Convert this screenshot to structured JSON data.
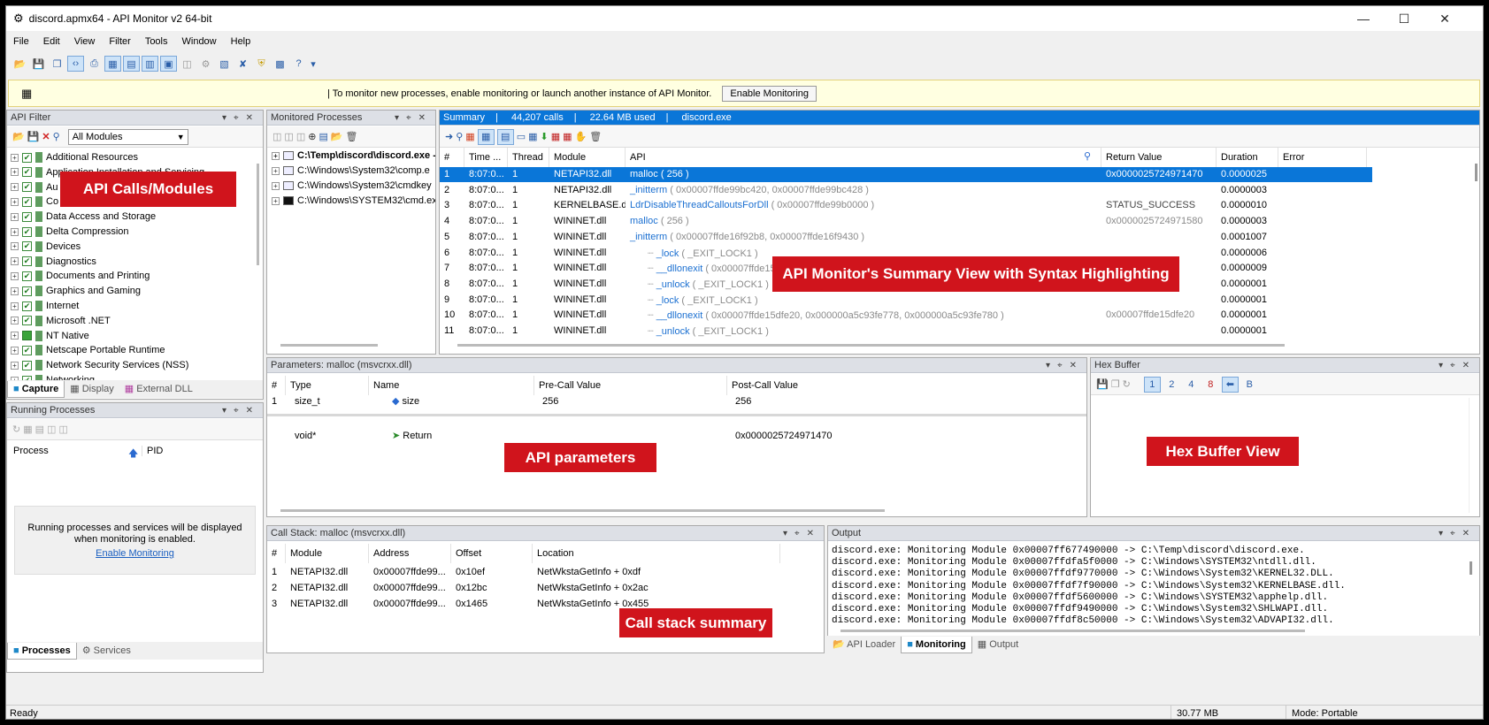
{
  "window": {
    "title": "discord.apmx64 - API Monitor v2 64-bit"
  },
  "menu": [
    "File",
    "Edit",
    "View",
    "Filter",
    "Tools",
    "Window",
    "Help"
  ],
  "infobar": {
    "message": "|  To monitor new processes, enable monitoring or launch another instance of API Monitor.",
    "button": "Enable Monitoring"
  },
  "api_filter": {
    "title": "API Filter",
    "module_select": "All Modules",
    "items": [
      "Additional Resources",
      "Application Installation and Servicing",
      "Au",
      "Co",
      "Data Access and Storage",
      "Delta Compression",
      "Devices",
      "Diagnostics",
      "Documents and Printing",
      "Graphics and Gaming",
      "Internet",
      "Microsoft .NET",
      "NT Native",
      "Netscape Portable Runtime",
      "Network Security Services (NSS)",
      "Networking"
    ],
    "tabs": [
      "Capture",
      "Display",
      "External DLL"
    ]
  },
  "monitored": {
    "title": "Monitored Processes",
    "items": [
      "C:\\Temp\\discord\\discord.exe -",
      "C:\\Windows\\System32\\comp.e",
      "C:\\Windows\\System32\\cmdkey",
      "C:\\Windows\\SYSTEM32\\cmd.ex"
    ]
  },
  "summary": {
    "header": {
      "label": "Summary",
      "calls": "44,207 calls",
      "mem": "22.64 MB used",
      "proc": "discord.exe"
    },
    "columns": [
      "#",
      "Time ...",
      "Thread",
      "Module",
      "API",
      "Return Value",
      "Duration",
      "Error"
    ],
    "rows": [
      {
        "n": "1",
        "time": "8:07:0...",
        "thread": "1",
        "module": "NETAPI32.dll",
        "fn": "malloc",
        "args": " ( 256 )",
        "ret": "0x0000025724971470",
        "dur": "0.0000025"
      },
      {
        "n": "2",
        "time": "8:07:0...",
        "thread": "1",
        "module": "NETAPI32.dll",
        "fn": "_initterm",
        "args": " ( 0x00007ffde99bc420, 0x00007ffde99bc428 )",
        "ret": "",
        "dur": "0.0000003"
      },
      {
        "n": "3",
        "time": "8:07:0...",
        "thread": "1",
        "module": "KERNELBASE.dll",
        "fn": "LdrDisableThreadCalloutsForDll",
        "args": " ( 0x00007ffde99b0000 )",
        "ret": "STATUS_SUCCESS",
        "dur": "0.0000010"
      },
      {
        "n": "4",
        "time": "8:07:0...",
        "thread": "1",
        "module": "WININET.dll",
        "fn": "malloc",
        "args": " ( 256 )",
        "ret": "0x0000025724971580",
        "dur": "0.0000003"
      },
      {
        "n": "5",
        "time": "8:07:0...",
        "thread": "1",
        "module": "WININET.dll",
        "fn": "_initterm",
        "args": " ( 0x00007ffde16f92b8, 0x00007ffde16f9430 )",
        "ret": "",
        "dur": "0.0001007"
      },
      {
        "n": "6",
        "time": "8:07:0...",
        "thread": "1",
        "module": "WININET.dll",
        "fn": "_lock",
        "args": " ( _EXIT_LOCK1 )",
        "ret": "",
        "dur": "0.0000006"
      },
      {
        "n": "7",
        "time": "8:07:0...",
        "thread": "1",
        "module": "WININET.dll",
        "fn": "__dllonexit",
        "args": " ( 0x00007ffde15dfd",
        "ret": "a0",
        "dur": "0.0000009"
      },
      {
        "n": "8",
        "time": "8:07:0...",
        "thread": "1",
        "module": "WININET.dll",
        "fn": "_unlock",
        "args": " ( _EXIT_LOCK1 )",
        "ret": "",
        "dur": "0.0000001"
      },
      {
        "n": "9",
        "time": "8:07:0...",
        "thread": "1",
        "module": "WININET.dll",
        "fn": "_lock",
        "args": " ( _EXIT_LOCK1 )",
        "ret": "",
        "dur": "0.0000001"
      },
      {
        "n": "10",
        "time": "8:07:0...",
        "thread": "1",
        "module": "WININET.dll",
        "fn": "__dllonexit",
        "args": " ( 0x00007ffde15dfe20, 0x000000a5c93fe778, 0x000000a5c93fe780 )",
        "ret": "0x00007ffde15dfe20",
        "dur": "0.0000001"
      },
      {
        "n": "11",
        "time": "8:07:0...",
        "thread": "1",
        "module": "WININET.dll",
        "fn": "_unlock",
        "args": " ( _EXIT_LOCK1 )",
        "ret": "",
        "dur": "0.0000001"
      }
    ]
  },
  "params": {
    "title": "Parameters: malloc (msvcrxx.dll)",
    "columns": [
      "#",
      "Type",
      "Name",
      "Pre-Call Value",
      "Post-Call Value"
    ],
    "row1": {
      "n": "1",
      "type": "size_t",
      "name": "size",
      "pre": "256",
      "post": "256"
    },
    "ret": {
      "type": "void*",
      "name": "Return",
      "post": "0x0000025724971470"
    }
  },
  "hex": {
    "title": "Hex Buffer",
    "buttons": [
      "1",
      "2",
      "4",
      "8",
      "B"
    ]
  },
  "running": {
    "title": "Running Processes",
    "cols": [
      "Process",
      "PID"
    ],
    "msg1": "Running processes and services will be displayed",
    "msg2": "when monitoring is enabled.",
    "link": "Enable Monitoring",
    "tabs": [
      "Processes",
      "Services"
    ]
  },
  "callstack": {
    "title": "Call Stack: malloc (msvcrxx.dll)",
    "columns": [
      "#",
      "Module",
      "Address",
      "Offset",
      "Location"
    ],
    "rows": [
      {
        "n": "1",
        "module": "NETAPI32.dll",
        "addr": "0x00007ffde99...",
        "off": "0x10ef",
        "loc": "NetWkstaGetInfo + 0xdf"
      },
      {
        "n": "2",
        "module": "NETAPI32.dll",
        "addr": "0x00007ffde99...",
        "off": "0x12bc",
        "loc": "NetWkstaGetInfo + 0x2ac"
      },
      {
        "n": "3",
        "module": "NETAPI32.dll",
        "addr": "0x00007ffde99...",
        "off": "0x1465",
        "loc": "NetWkstaGetInfo + 0x455"
      }
    ]
  },
  "output": {
    "title": "Output",
    "lines": [
      "discord.exe: Monitoring Module 0x00007ff677490000 -> C:\\Temp\\discord\\discord.exe.",
      "discord.exe: Monitoring Module 0x00007ffdfa5f0000 -> C:\\Windows\\SYSTEM32\\ntdll.dll.",
      "discord.exe: Monitoring Module 0x00007ffdf9770000 -> C:\\Windows\\System32\\KERNEL32.DLL.",
      "discord.exe: Monitoring Module 0x00007ffdf7f90000 -> C:\\Windows\\System32\\KERNELBASE.dll.",
      "discord.exe: Monitoring Module 0x00007ffdf5600000 -> C:\\Windows\\SYSTEM32\\apphelp.dll.",
      "discord.exe: Monitoring Module 0x00007ffdf9490000 -> C:\\Windows\\System32\\SHLWAPI.dll.",
      "discord.exe: Monitoring Module 0x00007ffdf8c50000 -> C:\\Windows\\System32\\ADVAPI32.dll."
    ],
    "tabs": [
      "API Loader",
      "Monitoring",
      "Output"
    ]
  },
  "status": {
    "left": "Ready",
    "mem": "30.77 MB",
    "mode": "Mode: Portable"
  },
  "labels": {
    "calls": "API Calls/Modules",
    "summary": "API Monitor's Summary View with Syntax Highlighting",
    "params": "API parameters",
    "hex": "Hex Buffer View",
    "stack": "Call stack summary"
  }
}
